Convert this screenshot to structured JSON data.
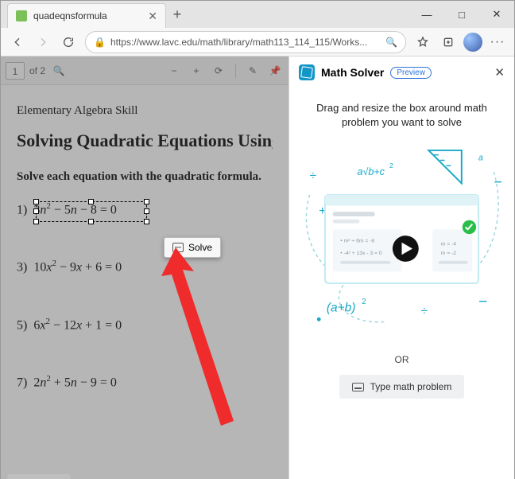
{
  "window": {
    "minimize": "—",
    "maximize": "□",
    "close": "✕"
  },
  "tab": {
    "title": "quadeqnsformula",
    "close": "✕",
    "new": "+"
  },
  "nav": {
    "url": "https://www.lavc.edu/math/library/math113_114_115/Works..."
  },
  "pdfbar": {
    "page_current": "1",
    "page_total": "of 2",
    "zoom_out": "−",
    "zoom_in": "+",
    "rotate": "⟳"
  },
  "doc": {
    "skill": "Elementary Algebra Skill",
    "title": "Solving Quadratic Equations Using the Quadratic Formula",
    "instr": "Solve each equation with the quadratic formula.",
    "eqs": [
      "3n² − 5n − 8 = 0",
      "10x² − 9x + 6 = 0",
      "6x² − 12x + 1 = 0",
      "2n² + 5n − 9 = 0"
    ],
    "nums": [
      "1)",
      "3)",
      "5)",
      "7)"
    ]
  },
  "solve": {
    "label": "Solve"
  },
  "panel": {
    "title": "Math Solver",
    "badge": "Preview",
    "msg": "Drag and resize the box around math problem you want to solve",
    "or": "OR",
    "type": "Type math problem"
  },
  "illus": {
    "l1": "m² + 6m = -8",
    "l2": "-4² + 13x - 3 = 0",
    "r1": "m  = -4",
    "r2": "m  = -2",
    "ab": "(a+b)",
    "abc": "a√b+c",
    "sq": "2"
  }
}
